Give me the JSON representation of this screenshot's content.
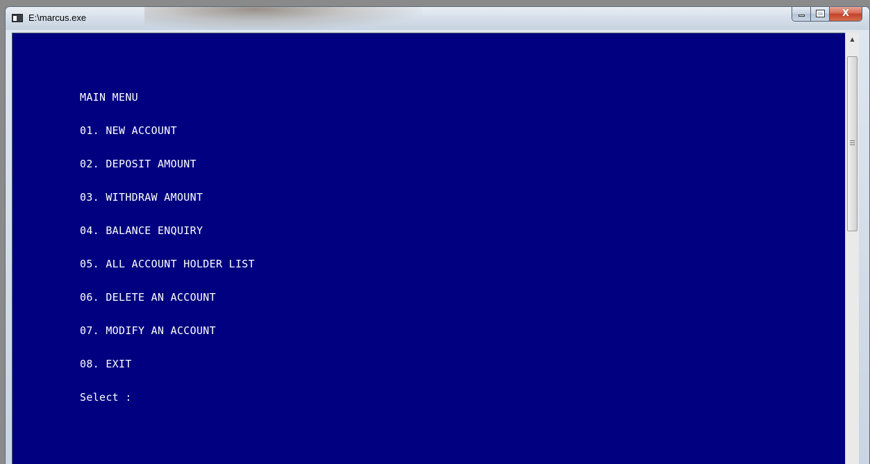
{
  "window": {
    "title": "E:\\marcus.exe",
    "close_glyph": "X"
  },
  "console": {
    "lines": [
      "MAIN MENU",
      "01. NEW ACCOUNT",
      "02. DEPOSIT AMOUNT",
      "03. WITHDRAW AMOUNT",
      "04. BALANCE ENQUIRY",
      "05. ALL ACCOUNT HOLDER LIST",
      "06. DELETE AN ACCOUNT",
      "07. MODIFY AN ACCOUNT",
      "08. EXIT",
      "Select :"
    ],
    "background_color": "#000080",
    "text_color": "#ffffff"
  },
  "scrollbar": {
    "up_arrow": "▲"
  },
  "icons": {
    "app": "console-app-icon",
    "minimize": "minimize-icon",
    "maximize": "maximize-icon",
    "close": "close-icon",
    "scroll_up": "scroll-up-arrow-icon",
    "grip": "scroll-grip-icon"
  }
}
